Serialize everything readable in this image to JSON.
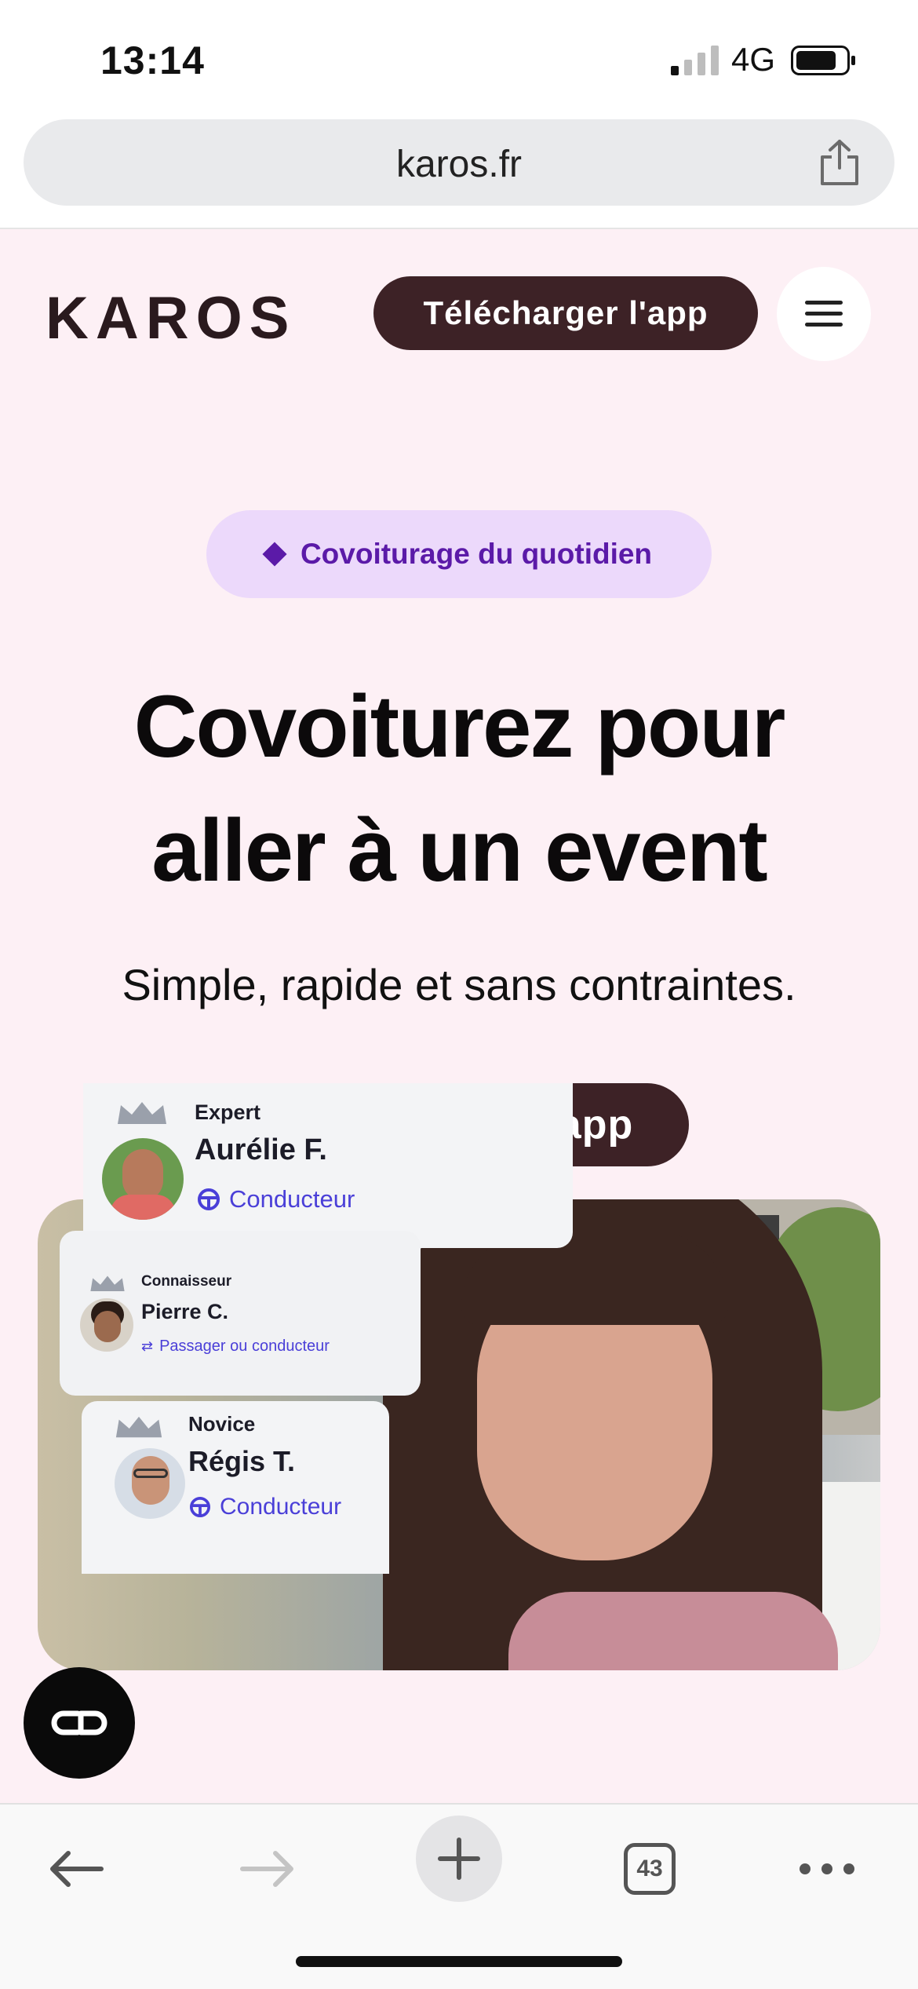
{
  "status_bar": {
    "time": "13:14",
    "network": "4G"
  },
  "browser": {
    "url": "karos.fr",
    "tab_count": "43"
  },
  "header": {
    "logo": "KAROS",
    "download_label": "Télécharger l'app"
  },
  "hero": {
    "tag": "Covoiturage du quotidien",
    "title": "Covoiturez pour aller à un event",
    "subtitle": "Simple, rapide et sans contraintes.",
    "download_label": "Télécharger l'app"
  },
  "cards": [
    {
      "level": "Expert",
      "name": "Aurélie F.",
      "role": "Conducteur"
    },
    {
      "level": "Connaisseur",
      "name": "Pierre C.",
      "role": "Passager ou conducteur"
    },
    {
      "level": "Novice",
      "name": "Régis T.",
      "role": "Conducteur"
    }
  ],
  "colors": {
    "page_background": "#fdf0f5",
    "primary_button": "#3d2226",
    "tag_background": "#ecd9fb",
    "tag_text": "#5b1aa8",
    "role_text": "#4a3fd8"
  },
  "icons": {
    "share": "share-icon",
    "menu": "hamburger-icon",
    "chat": "chat-widget-icon",
    "back": "back-arrow-icon",
    "forward": "forward-arrow-icon",
    "new_tab": "plus-icon",
    "tabs": "tabs-icon",
    "more": "more-icon"
  }
}
